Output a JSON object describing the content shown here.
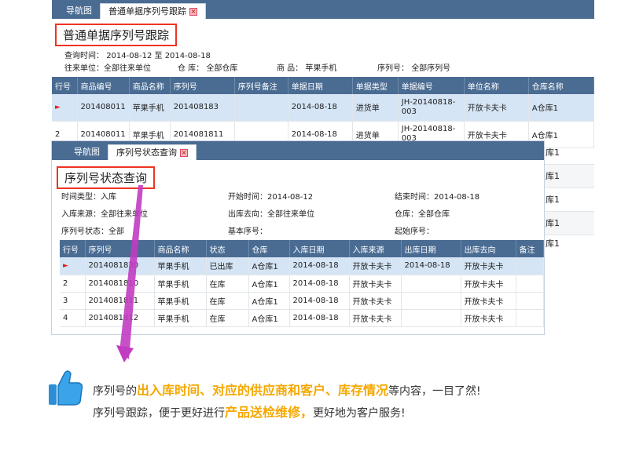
{
  "back": {
    "tabs": [
      {
        "label": "导航图"
      },
      {
        "label": "普通单据序列号跟踪"
      }
    ],
    "title": "普通单据序列号跟踪",
    "query_time_label": "查询时间：",
    "query_time_from": "2014-08-12",
    "query_time_to_word": "至",
    "query_time_to": "2014-08-18",
    "partner_label": "往来单位：",
    "partner_value": "全部往来单位",
    "warehouse_label": "仓 库：",
    "warehouse_value": "全部仓库",
    "product_label": "商 品：",
    "product_value": "苹果手机",
    "serial_label": "序列号：",
    "serial_value": "全部序列号",
    "columns": [
      "行号",
      "商品编号",
      "商品名称",
      "序列号",
      "序列号备注",
      "单据日期",
      "单据类型",
      "单据编号",
      "单位名称",
      "仓库名称"
    ],
    "rows": [
      {
        "no": "",
        "code": "201408011",
        "name": "苹果手机",
        "serial": "201408183",
        "note": "",
        "date": "2014-08-18",
        "type": "进货单",
        "bill": "JH-20140818-003",
        "unit": "开放卡夫卡",
        "wh": "A仓库1"
      },
      {
        "no": "2",
        "code": "201408011",
        "name": "苹果手机",
        "serial": "2014081811",
        "note": "",
        "date": "2014-08-18",
        "type": "进货单",
        "bill": "JH-20140818-003",
        "unit": "开放卡夫卡",
        "wh": "A仓库1"
      }
    ],
    "extra_wh": [
      "库1",
      "库1",
      "库1",
      "库1",
      "库1"
    ]
  },
  "front": {
    "tabs": [
      {
        "label": "导航图"
      },
      {
        "label": "序列号状态查询"
      }
    ],
    "title": "序列号状态查询",
    "time_type_label": "时间类型：",
    "time_type_value": "入库",
    "start_label": "开始时间：",
    "start_value": "2014-08-12",
    "end_label": "结束时间：",
    "end_value": "2014-08-18",
    "source_label": "入库来源：",
    "source_value": "全部往来单位",
    "dest_label": "出库去向：",
    "dest_value": "全部往来单位",
    "warehouse_label": "仓库：",
    "warehouse_value": "全部仓库",
    "status_label": "序列号状态：",
    "status_value": "全部",
    "base_label": "基本序号：",
    "start_serial_label": "起始序号：",
    "columns": [
      "行号",
      "序列号",
      "商品名称",
      "状态",
      "仓库",
      "入库日期",
      "入库来源",
      "出库日期",
      "出库去向",
      "备注"
    ],
    "rows": [
      {
        "no": "",
        "serial": "2014081830",
        "name": "苹果手机",
        "status": "已出库",
        "wh": "A仓库1",
        "indate": "2014-08-18",
        "src": "开放卡夫卡",
        "outdate": "2014-08-18",
        "dest": "开放卡夫卡",
        "note": ""
      },
      {
        "no": "2",
        "serial": "2014081810",
        "name": "苹果手机",
        "status": "在库",
        "wh": "A仓库1",
        "indate": "2014-08-18",
        "src": "开放卡夫卡",
        "outdate": "",
        "dest": "开放卡夫卡",
        "note": ""
      },
      {
        "no": "3",
        "serial": "2014081811",
        "name": "苹果手机",
        "status": "在库",
        "wh": "A仓库1",
        "indate": "2014-08-18",
        "src": "开放卡夫卡",
        "outdate": "",
        "dest": "开放卡夫卡",
        "note": ""
      },
      {
        "no": "4",
        "serial": "2014081812",
        "name": "苹果手机",
        "status": "在库",
        "wh": "A仓库1",
        "indate": "2014-08-18",
        "src": "开放卡夫卡",
        "outdate": "",
        "dest": "开放卡夫卡",
        "note": ""
      }
    ]
  },
  "footer": {
    "l1_a": "序列号的",
    "l1_hl": "出入库时间、对应的供应商和客户、库存情况",
    "l1_b": "等内容，一目了然!",
    "l2_a": "序列号跟踪，便于更好进行",
    "l2_hl": "产品送检维修，",
    "l2_b": "更好地为客户服务!"
  },
  "colors": {
    "header": "#4a6c93",
    "highlight": "#f5a800",
    "red_box": "#e32",
    "arrow": "#c13cc1"
  }
}
